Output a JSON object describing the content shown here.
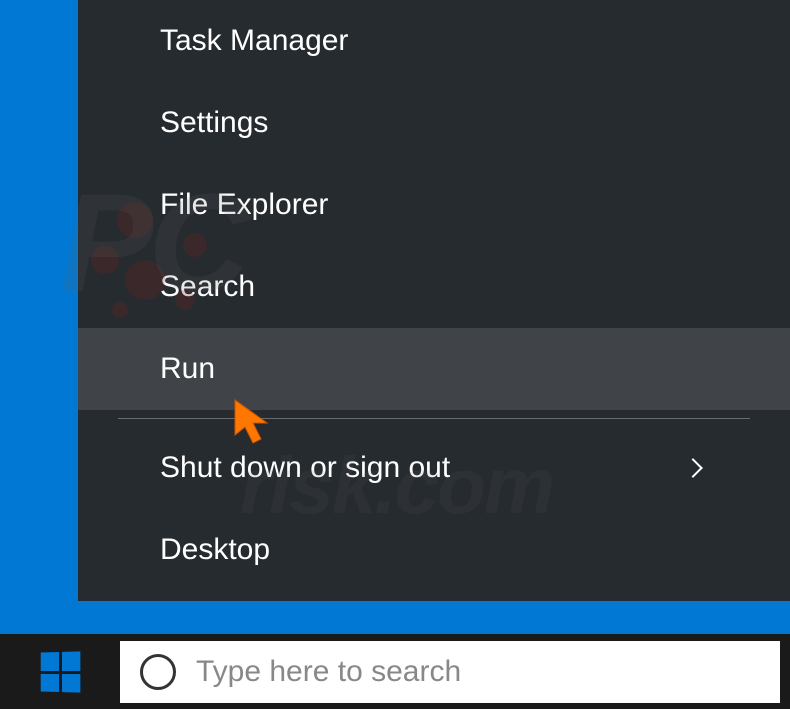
{
  "menu": {
    "items": [
      {
        "label": "Task Manager",
        "highlighted": false,
        "hasSubmenu": false
      },
      {
        "label": "Settings",
        "highlighted": false,
        "hasSubmenu": false
      },
      {
        "label": "File Explorer",
        "highlighted": false,
        "hasSubmenu": false
      },
      {
        "label": "Search",
        "highlighted": false,
        "hasSubmenu": false
      },
      {
        "label": "Run",
        "highlighted": true,
        "hasSubmenu": false
      }
    ],
    "itemsAfterDivider": [
      {
        "label": "Shut down or sign out",
        "highlighted": false,
        "hasSubmenu": true
      },
      {
        "label": "Desktop",
        "highlighted": false,
        "hasSubmenu": false
      }
    ]
  },
  "search": {
    "placeholder": "Type here to search"
  },
  "watermark": {
    "main": "PC",
    "sub": "risk.com"
  }
}
